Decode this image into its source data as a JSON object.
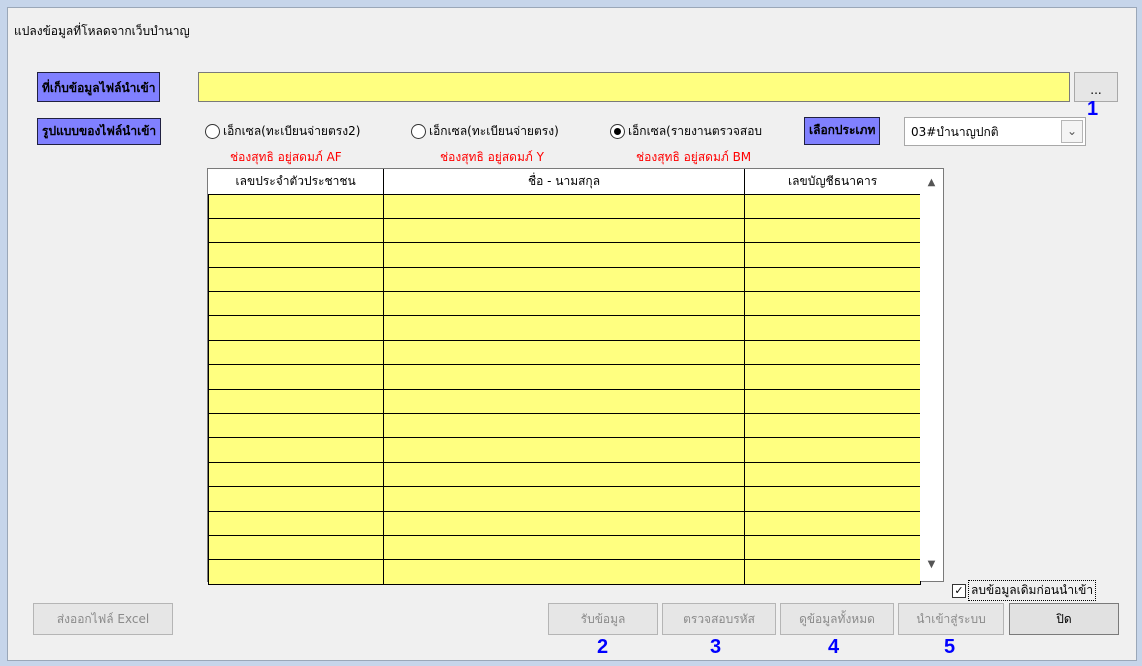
{
  "window": {
    "title": "แปลงข้อมูลที่โหลดจากเว็บบำนาญ"
  },
  "file_location": {
    "label": "ที่เก็บข้อมูลไฟล์นำเข้า",
    "value": "",
    "browse_label": "..."
  },
  "file_format": {
    "label": "รูปแบบของไฟล์นำเข้า",
    "options": [
      {
        "label": "เอ็กเซล(ทะเบียนจ่ายตรง2)",
        "note": "ช่องสุทธิ อยู่สดมภ์ AF",
        "selected": false
      },
      {
        "label": "เอ็กเซล(ทะเบียนจ่ายตรง)",
        "note": "ช่องสุทธิ อยู่สดมภ์ Y",
        "selected": false
      },
      {
        "label": "เอ็กเซล(รายงานตรวจสอบ",
        "note": "ช่องสุทธิ อยู่สดมภ์ BM",
        "selected": true
      }
    ]
  },
  "type_select": {
    "label": "เลือกประเภท",
    "value": "03#บำนาญปกติ"
  },
  "grid": {
    "columns": [
      "เลขประจำตัวประชาชน",
      "ชื่อ - นามสกุล",
      "เลขบัญชีธนาคาร"
    ],
    "row_count": 16
  },
  "delete_checkbox": {
    "label": "ลบข้อมูลเดิมก่อนนำเข้า",
    "checked": true
  },
  "buttons": {
    "export_excel": "ส่งออกไฟล์ Excel",
    "receive": "รับข้อมูล",
    "verify": "ตรวจสอบรหัส",
    "view_all": "ดูข้อมูลทั้งหมด",
    "import": "นำเข้าสู่ระบบ",
    "close": "ปิด"
  },
  "step_numbers": [
    "1",
    "2",
    "3",
    "4",
    "5"
  ],
  "colors": {
    "label_bg": "#8080ff",
    "field_bg": "#ffff80",
    "step_number": "#0000ff",
    "note": "#ff0000"
  }
}
